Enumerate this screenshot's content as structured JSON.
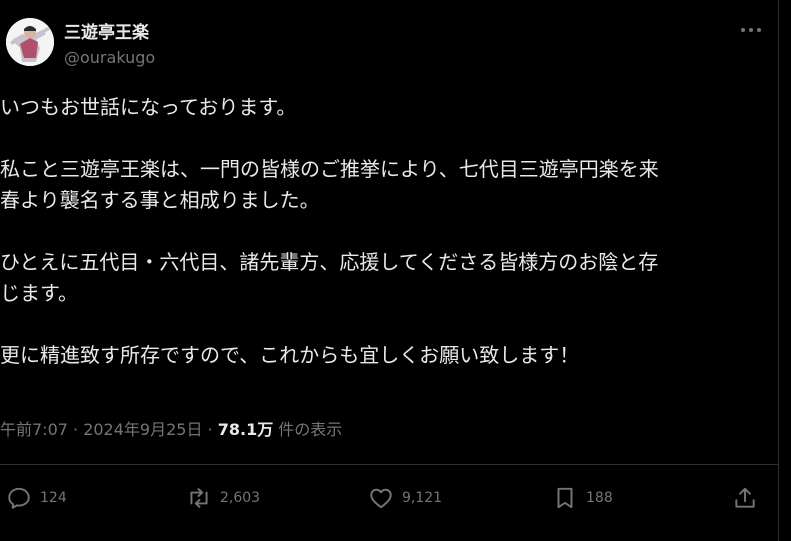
{
  "author": {
    "display_name": "三遊亭王楽",
    "handle": "@ourakugo"
  },
  "tweet": {
    "paragraphs": [
      [
        "いつもお世話になっております。"
      ],
      [
        "私こと三遊亭王楽は、一門の皆様のご推挙により、七代目三遊亭円楽を来",
        "春より襲名する事と相成りました。"
      ],
      [
        "ひとえに五代目・六代目、諸先輩方、応援してくださる皆様方のお陰と存",
        "じます。"
      ],
      [
        "更に精進致す所存ですので、これからも宜しくお願い致します！"
      ]
    ]
  },
  "meta": {
    "time_date": "午前7:07 · 2024年9月25日 · ",
    "views_count": "78.1万",
    "views_label": " 件の表示"
  },
  "actions": {
    "replies": "124",
    "reposts": "2,603",
    "likes": "9,121",
    "bookmarks": "188"
  },
  "icons": {
    "more": "more-horizontal-icon",
    "reply": "reply-icon",
    "repost": "repost-icon",
    "like": "heart-icon",
    "bookmark": "bookmark-icon",
    "share": "share-icon"
  },
  "colors": {
    "background": "#000000",
    "text_primary": "#e7e9ea",
    "text_secondary": "#71767b",
    "divider": "#2f3336"
  }
}
